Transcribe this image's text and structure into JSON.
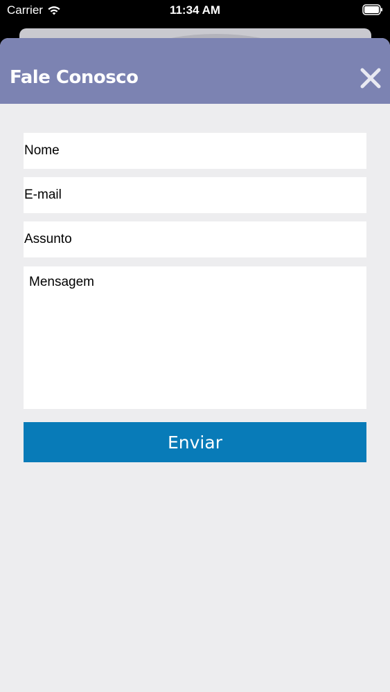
{
  "status_bar": {
    "carrier": "Carrier",
    "time": "11:34 AM",
    "wifi_icon": "wifi-icon",
    "battery_icon": "battery-icon"
  },
  "modal": {
    "title": "Fale Conosco",
    "close_icon": "close-icon",
    "header_color": "#7c83b2"
  },
  "form": {
    "name_placeholder": "Nome",
    "email_placeholder": "E-mail",
    "subject_placeholder": "Assunto",
    "message_placeholder": "Mensagem",
    "send_label": "Enviar",
    "send_color": "#087bb8"
  }
}
